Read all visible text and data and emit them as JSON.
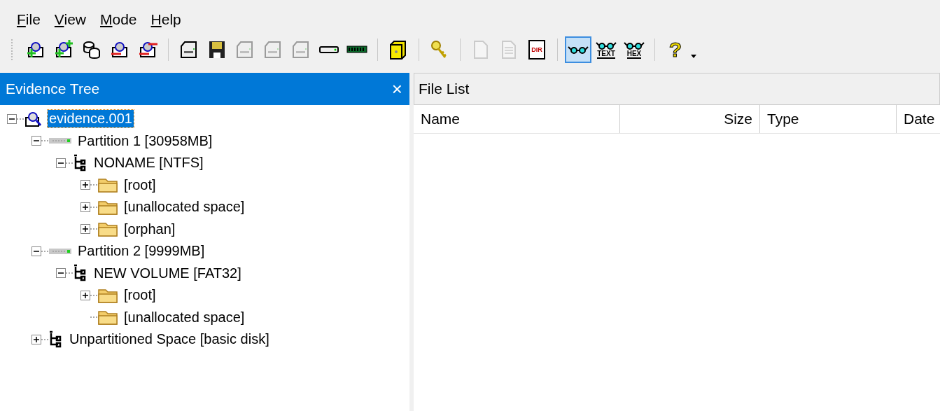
{
  "menu": [
    {
      "label": "File"
    },
    {
      "label": "View"
    },
    {
      "label": "Mode"
    },
    {
      "label": "Help"
    }
  ],
  "toolbar": [
    {
      "kind": "button",
      "disabled": false,
      "selected": false
    },
    {
      "kind": "button",
      "disabled": false,
      "selected": false
    },
    {
      "kind": "button",
      "disabled": false,
      "selected": false
    },
    {
      "kind": "button",
      "disabled": false,
      "selected": false
    },
    {
      "kind": "button",
      "disabled": false,
      "selected": false
    },
    {
      "kind": "separator"
    },
    {
      "kind": "button",
      "disabled": false,
      "selected": false
    },
    {
      "kind": "button",
      "disabled": false,
      "selected": false
    },
    {
      "kind": "button",
      "disabled": true,
      "selected": false
    },
    {
      "kind": "button",
      "disabled": true,
      "selected": false
    },
    {
      "kind": "button",
      "disabled": true,
      "selected": false
    },
    {
      "kind": "button",
      "disabled": false,
      "selected": false
    },
    {
      "kind": "button",
      "disabled": false,
      "selected": false
    },
    {
      "kind": "separator"
    },
    {
      "kind": "button",
      "disabled": false,
      "selected": false
    },
    {
      "kind": "separator"
    },
    {
      "kind": "button",
      "disabled": false,
      "selected": false
    },
    {
      "kind": "separator"
    },
    {
      "kind": "button",
      "disabled": true,
      "selected": false
    },
    {
      "kind": "button",
      "disabled": true,
      "selected": false
    },
    {
      "kind": "labeled",
      "label": "DIR",
      "disabled": false,
      "selected": false
    },
    {
      "kind": "separator"
    },
    {
      "kind": "button",
      "disabled": false,
      "selected": true
    },
    {
      "kind": "labeled",
      "label": "TEXT",
      "disabled": false,
      "selected": false
    },
    {
      "kind": "labeled",
      "label": "HEX",
      "disabled": false,
      "selected": false
    },
    {
      "kind": "separator"
    },
    {
      "kind": "glyph",
      "label": "?"
    },
    {
      "kind": "dropdown"
    }
  ],
  "evidence_tree": {
    "title": "Evidence Tree",
    "close": "×",
    "nodes": [
      {
        "label": "evidence.001",
        "kind": "image",
        "expanded": true,
        "selected": true,
        "children": [
          {
            "label": "Partition 1 [30958MB]",
            "kind": "partition",
            "expanded": true,
            "selected": false,
            "children": [
              {
                "label": "NONAME [NTFS]",
                "kind": "volume",
                "expanded": true,
                "selected": false,
                "children": [
                  {
                    "label": "[root]",
                    "kind": "folder",
                    "expanded": false,
                    "selected": false
                  },
                  {
                    "label": "[unallocated space]",
                    "kind": "folder",
                    "expanded": false,
                    "selected": false
                  },
                  {
                    "label": "[orphan]",
                    "kind": "folder",
                    "expanded": false,
                    "selected": false
                  }
                ]
              }
            ]
          },
          {
            "label": "Partition 2 [9999MB]",
            "kind": "partition",
            "expanded": true,
            "selected": false,
            "children": [
              {
                "label": "NEW VOLUME [FAT32]",
                "kind": "volume",
                "expanded": true,
                "selected": false,
                "children": [
                  {
                    "label": "[root]",
                    "kind": "folder",
                    "expanded": false,
                    "selected": false
                  },
                  {
                    "label": "[unallocated space]",
                    "kind": "folder",
                    "selected": false
                  }
                ]
              }
            ]
          },
          {
            "label": "Unpartitioned Space [basic disk]",
            "kind": "volume",
            "expanded": false,
            "selected": false
          }
        ]
      }
    ]
  },
  "file_list": {
    "title": "File List",
    "columns": [
      {
        "label": "Name"
      },
      {
        "label": "Size"
      },
      {
        "label": "Type"
      },
      {
        "label": "Date"
      }
    ]
  }
}
